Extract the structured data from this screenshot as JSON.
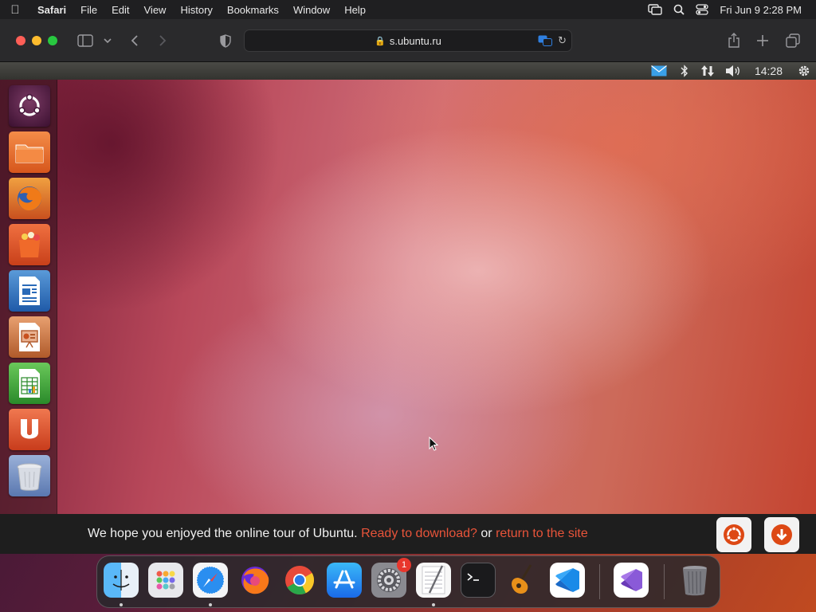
{
  "menubar": {
    "app_name": "Safari",
    "items": [
      "File",
      "Edit",
      "View",
      "History",
      "Bookmarks",
      "Window",
      "Help"
    ],
    "datetime": "Fri Jun 9  2:28 PM"
  },
  "safari": {
    "url": "s.ubuntu.ru"
  },
  "ubuntu_panel": {
    "clock": "14:28"
  },
  "launcher": {
    "items": [
      "dash-home",
      "files",
      "firefox",
      "software-center",
      "libreoffice-writer",
      "libreoffice-impress",
      "libreoffice-calc",
      "ubuntu-one",
      "trash"
    ]
  },
  "tour_bar": {
    "message": "We hope you enjoyed the online tour of Ubuntu.",
    "download_link": "Ready to download?",
    "or_text": "or",
    "return_link": "return to the site"
  },
  "dock": {
    "apps": [
      "finder",
      "launchpad",
      "safari",
      "firefox",
      "chrome",
      "app-store",
      "system-settings",
      "textedit",
      "terminal",
      "garageband",
      "vscode",
      "visual-studio",
      "trash"
    ],
    "system_settings_badge": "1"
  },
  "colors": {
    "accent_link": "#e8543a",
    "ubuntu_orange": "#dd4814"
  }
}
